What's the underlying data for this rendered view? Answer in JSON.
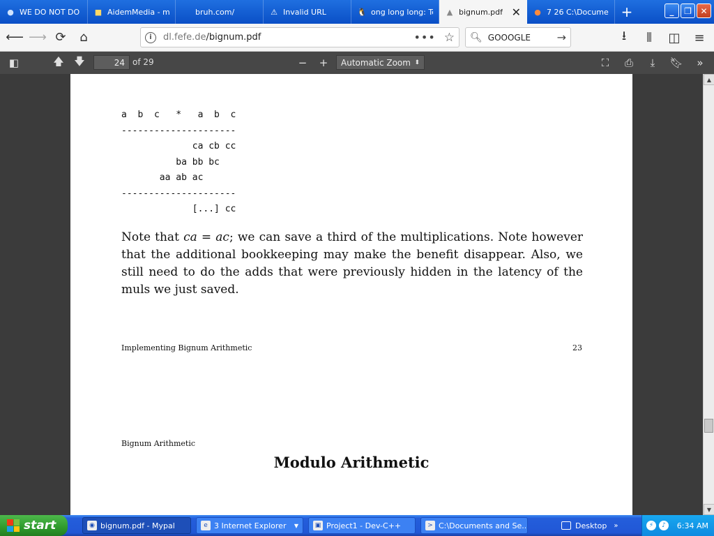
{
  "tabs": [
    {
      "label": "WE DO NOT DO",
      "icon": "search-icon",
      "active": false
    },
    {
      "label": "AidemMedia - mi",
      "icon": "folder-icon",
      "active": false
    },
    {
      "label": "bruh.com/",
      "icon": "",
      "active": false
    },
    {
      "label": "Invalid URL",
      "icon": "warning-icon",
      "active": false
    },
    {
      "label": "ong long long: To",
      "icon": "penguin-icon",
      "active": false
    },
    {
      "label": "bignum.pdf",
      "icon": "pdf-icon",
      "active": true
    },
    {
      "label": "7 26 C:\\Documen",
      "icon": "firefox-icon",
      "active": false
    }
  ],
  "newtab_label": "+",
  "window": {
    "minimize": "_",
    "restore": "❐",
    "close": "✕"
  },
  "nav": {
    "url_host": "dl.fefe.de",
    "url_path": "/bignum.pdf",
    "search_value": "GOOOGLE"
  },
  "pdf_toolbar": {
    "page_number": "24",
    "page_count": "of 29",
    "zoom_label": "Automatic Zoom"
  },
  "document": {
    "code_lines": [
      "a  b  c   *   a  b  c",
      "---------------------",
      "             ca cb cc",
      "          ba bb bc",
      "       aa ab ac",
      "---------------------",
      "             [...] cc"
    ],
    "para_prefix": "Note that ",
    "para_math": "ca = ac",
    "para_rest": "; we can save a third of the multiplications. Note however that the additional bookkeeping may make the benefit disappear. Also, we still need to do the adds that were previously hidden in the latency of the muls we just saved.",
    "footer_left": "Implementing Bignum Arithmetic",
    "footer_page": "23",
    "next_header": "Bignum Arithmetic",
    "section_title": "Modulo Arithmetic"
  },
  "taskbar": {
    "start_label": "start",
    "tasks": [
      {
        "label": "bignum.pdf - Mypal",
        "active": true
      },
      {
        "label": "3 Internet Explorer",
        "active": false
      },
      {
        "label": "Project1 - Dev-C++",
        "active": false
      },
      {
        "label": "C:\\Documents and Se...",
        "active": false
      }
    ],
    "desktop_label": "Desktop",
    "clock": "6:34 AM"
  }
}
